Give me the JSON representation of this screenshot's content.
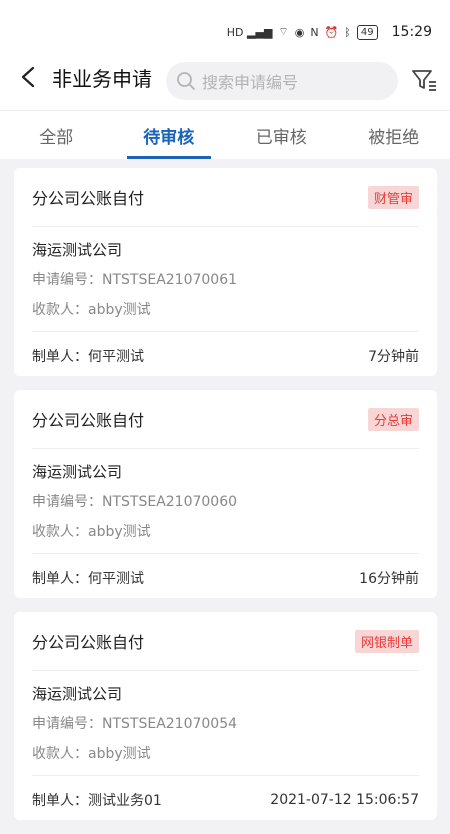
{
  "status_bar": {
    "time": "15:29",
    "battery": "49",
    "icons": [
      "hd-signal-1-icon",
      "hd-signal-2-icon",
      "wifi-icon",
      "weibo-icon",
      "browser-icon",
      "mail-icon",
      "nfc-icon",
      "alarm-icon",
      "bluetooth-icon"
    ]
  },
  "header": {
    "title": "非业务申请",
    "search_placeholder": "搜索申请编号"
  },
  "tabs": [
    {
      "label": "全部"
    },
    {
      "label": "待审核"
    },
    {
      "label": "已审核"
    },
    {
      "label": "被拒绝"
    }
  ],
  "cards": [
    {
      "title": "分公司公账自付",
      "badge": "财管审",
      "company": "海运测试公司",
      "apply_no": "申请编号：NTSTSEA21070061",
      "payee": "收款人：abby测试",
      "creator": "制单人：何平测试",
      "time": "7分钟前"
    },
    {
      "title": "分公司公账自付",
      "badge": "分总审",
      "company": "海运测试公司",
      "apply_no": "申请编号：NTSTSEA21070060",
      "payee": "收款人：abby测试",
      "creator": "制单人：何平测试",
      "time": "16分钟前"
    },
    {
      "title": "分公司公账自付",
      "badge": "网银制单",
      "company": "海运测试公司",
      "apply_no": "申请编号：NTSTSEA21070054",
      "payee": "收款人：abby测试",
      "creator": "制单人：测试业务01",
      "time": "2021-07-12 15:06:57"
    }
  ],
  "colors": {
    "accent": "#1a63b8",
    "badge_bg": "#f9d6d6",
    "badge_text": "#e53b3b"
  }
}
